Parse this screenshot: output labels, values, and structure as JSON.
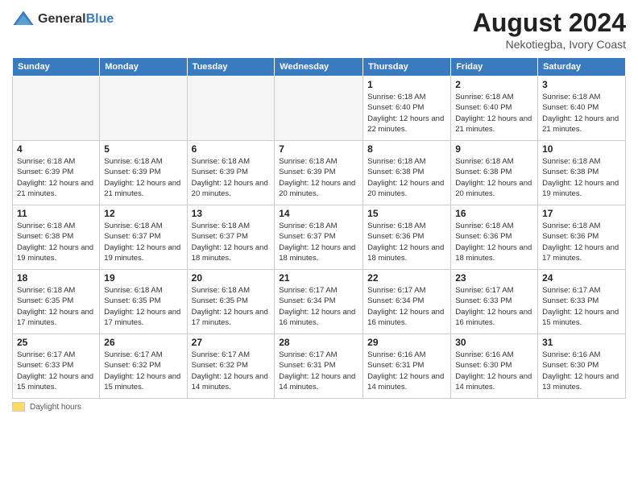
{
  "logo": {
    "general": "General",
    "blue": "Blue"
  },
  "title": "August 2024",
  "subtitle": "Nekotiegba, Ivory Coast",
  "days_of_week": [
    "Sunday",
    "Monday",
    "Tuesday",
    "Wednesday",
    "Thursday",
    "Friday",
    "Saturday"
  ],
  "legend_label": "Daylight hours",
  "weeks": [
    [
      {
        "num": "",
        "sunrise": "",
        "sunset": "",
        "daylight": "",
        "empty": true
      },
      {
        "num": "",
        "sunrise": "",
        "sunset": "",
        "daylight": "",
        "empty": true
      },
      {
        "num": "",
        "sunrise": "",
        "sunset": "",
        "daylight": "",
        "empty": true
      },
      {
        "num": "",
        "sunrise": "",
        "sunset": "",
        "daylight": "",
        "empty": true
      },
      {
        "num": "1",
        "sunrise": "Sunrise: 6:18 AM",
        "sunset": "Sunset: 6:40 PM",
        "daylight": "Daylight: 12 hours and 22 minutes."
      },
      {
        "num": "2",
        "sunrise": "Sunrise: 6:18 AM",
        "sunset": "Sunset: 6:40 PM",
        "daylight": "Daylight: 12 hours and 21 minutes."
      },
      {
        "num": "3",
        "sunrise": "Sunrise: 6:18 AM",
        "sunset": "Sunset: 6:40 PM",
        "daylight": "Daylight: 12 hours and 21 minutes."
      }
    ],
    [
      {
        "num": "4",
        "sunrise": "Sunrise: 6:18 AM",
        "sunset": "Sunset: 6:39 PM",
        "daylight": "Daylight: 12 hours and 21 minutes."
      },
      {
        "num": "5",
        "sunrise": "Sunrise: 6:18 AM",
        "sunset": "Sunset: 6:39 PM",
        "daylight": "Daylight: 12 hours and 21 minutes."
      },
      {
        "num": "6",
        "sunrise": "Sunrise: 6:18 AM",
        "sunset": "Sunset: 6:39 PM",
        "daylight": "Daylight: 12 hours and 20 minutes."
      },
      {
        "num": "7",
        "sunrise": "Sunrise: 6:18 AM",
        "sunset": "Sunset: 6:39 PM",
        "daylight": "Daylight: 12 hours and 20 minutes."
      },
      {
        "num": "8",
        "sunrise": "Sunrise: 6:18 AM",
        "sunset": "Sunset: 6:38 PM",
        "daylight": "Daylight: 12 hours and 20 minutes."
      },
      {
        "num": "9",
        "sunrise": "Sunrise: 6:18 AM",
        "sunset": "Sunset: 6:38 PM",
        "daylight": "Daylight: 12 hours and 20 minutes."
      },
      {
        "num": "10",
        "sunrise": "Sunrise: 6:18 AM",
        "sunset": "Sunset: 6:38 PM",
        "daylight": "Daylight: 12 hours and 19 minutes."
      }
    ],
    [
      {
        "num": "11",
        "sunrise": "Sunrise: 6:18 AM",
        "sunset": "Sunset: 6:38 PM",
        "daylight": "Daylight: 12 hours and 19 minutes."
      },
      {
        "num": "12",
        "sunrise": "Sunrise: 6:18 AM",
        "sunset": "Sunset: 6:37 PM",
        "daylight": "Daylight: 12 hours and 19 minutes."
      },
      {
        "num": "13",
        "sunrise": "Sunrise: 6:18 AM",
        "sunset": "Sunset: 6:37 PM",
        "daylight": "Daylight: 12 hours and 18 minutes."
      },
      {
        "num": "14",
        "sunrise": "Sunrise: 6:18 AM",
        "sunset": "Sunset: 6:37 PM",
        "daylight": "Daylight: 12 hours and 18 minutes."
      },
      {
        "num": "15",
        "sunrise": "Sunrise: 6:18 AM",
        "sunset": "Sunset: 6:36 PM",
        "daylight": "Daylight: 12 hours and 18 minutes."
      },
      {
        "num": "16",
        "sunrise": "Sunrise: 6:18 AM",
        "sunset": "Sunset: 6:36 PM",
        "daylight": "Daylight: 12 hours and 18 minutes."
      },
      {
        "num": "17",
        "sunrise": "Sunrise: 6:18 AM",
        "sunset": "Sunset: 6:36 PM",
        "daylight": "Daylight: 12 hours and 17 minutes."
      }
    ],
    [
      {
        "num": "18",
        "sunrise": "Sunrise: 6:18 AM",
        "sunset": "Sunset: 6:35 PM",
        "daylight": "Daylight: 12 hours and 17 minutes."
      },
      {
        "num": "19",
        "sunrise": "Sunrise: 6:18 AM",
        "sunset": "Sunset: 6:35 PM",
        "daylight": "Daylight: 12 hours and 17 minutes."
      },
      {
        "num": "20",
        "sunrise": "Sunrise: 6:18 AM",
        "sunset": "Sunset: 6:35 PM",
        "daylight": "Daylight: 12 hours and 17 minutes."
      },
      {
        "num": "21",
        "sunrise": "Sunrise: 6:17 AM",
        "sunset": "Sunset: 6:34 PM",
        "daylight": "Daylight: 12 hours and 16 minutes."
      },
      {
        "num": "22",
        "sunrise": "Sunrise: 6:17 AM",
        "sunset": "Sunset: 6:34 PM",
        "daylight": "Daylight: 12 hours and 16 minutes."
      },
      {
        "num": "23",
        "sunrise": "Sunrise: 6:17 AM",
        "sunset": "Sunset: 6:33 PM",
        "daylight": "Daylight: 12 hours and 16 minutes."
      },
      {
        "num": "24",
        "sunrise": "Sunrise: 6:17 AM",
        "sunset": "Sunset: 6:33 PM",
        "daylight": "Daylight: 12 hours and 15 minutes."
      }
    ],
    [
      {
        "num": "25",
        "sunrise": "Sunrise: 6:17 AM",
        "sunset": "Sunset: 6:33 PM",
        "daylight": "Daylight: 12 hours and 15 minutes."
      },
      {
        "num": "26",
        "sunrise": "Sunrise: 6:17 AM",
        "sunset": "Sunset: 6:32 PM",
        "daylight": "Daylight: 12 hours and 15 minutes."
      },
      {
        "num": "27",
        "sunrise": "Sunrise: 6:17 AM",
        "sunset": "Sunset: 6:32 PM",
        "daylight": "Daylight: 12 hours and 14 minutes."
      },
      {
        "num": "28",
        "sunrise": "Sunrise: 6:17 AM",
        "sunset": "Sunset: 6:31 PM",
        "daylight": "Daylight: 12 hours and 14 minutes."
      },
      {
        "num": "29",
        "sunrise": "Sunrise: 6:16 AM",
        "sunset": "Sunset: 6:31 PM",
        "daylight": "Daylight: 12 hours and 14 minutes."
      },
      {
        "num": "30",
        "sunrise": "Sunrise: 6:16 AM",
        "sunset": "Sunset: 6:30 PM",
        "daylight": "Daylight: 12 hours and 14 minutes."
      },
      {
        "num": "31",
        "sunrise": "Sunrise: 6:16 AM",
        "sunset": "Sunset: 6:30 PM",
        "daylight": "Daylight: 12 hours and 13 minutes."
      }
    ]
  ]
}
